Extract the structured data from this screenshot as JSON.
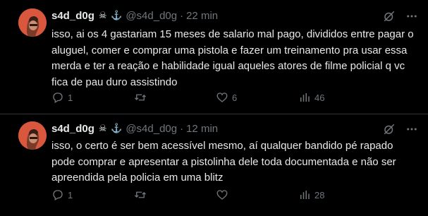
{
  "posts": [
    {
      "name": "s4d_d0g",
      "badges": "☠ ⚓",
      "handle": "@s4d_d0g",
      "dot": "·",
      "time": "22 min",
      "text": "isso, ai os 4 gastariam 15 meses de salario mal pago, divididos entre pagar o aluguel, comer e comprar uma pistola e fazer um treinamento pra usar essa merda e ter a reação e habilidade igual aqueles atores de filme policial q vc fica de pau duro assistindo",
      "replies": "1",
      "reposts": "",
      "likes": "6",
      "views": "46"
    },
    {
      "name": "s4d_d0g",
      "badges": "☠ ⚓",
      "handle": "@s4d_d0g",
      "dot": "·",
      "time": "12 min",
      "text": "isso, o certo é ser bem acessível mesmo, aí qualquer bandido pé rapado pode comprar e apresentar a pistolinha dele toda documentada e não ser apreendida pela policia em uma blitz",
      "replies": "1",
      "reposts": "",
      "likes": "",
      "views": "28"
    }
  ],
  "colors": {
    "background": "#000000",
    "text": "#e7e9ea",
    "muted": "#71767b",
    "avatar": "#d9573f"
  },
  "icons": [
    "avatar",
    "grok-icon",
    "more-icon",
    "reply-icon",
    "repost-icon",
    "like-icon",
    "views-icon"
  ]
}
